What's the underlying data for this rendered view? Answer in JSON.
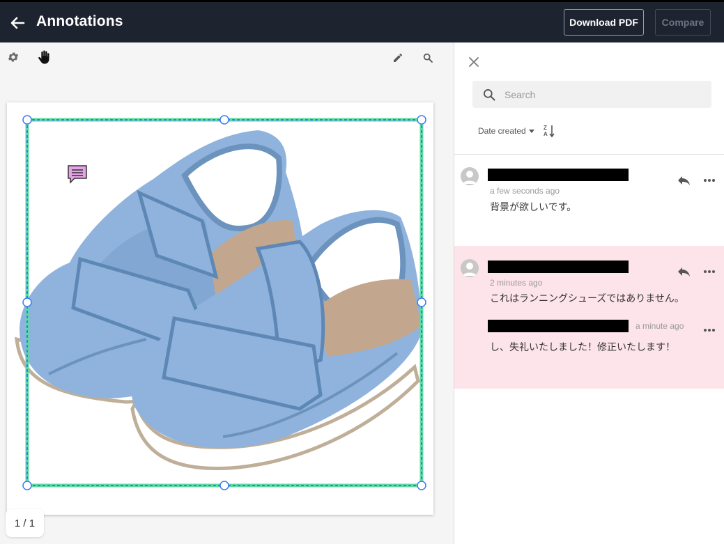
{
  "header": {
    "title": "Annotations",
    "download_label": "Download PDF",
    "compare_label": "Compare",
    "back_icon": "arrow-left-icon"
  },
  "viewer": {
    "tools": [
      "gear-icon",
      "hand-pan-icon",
      "pencil-icon",
      "search-icon"
    ],
    "page_indicator": "1 / 1",
    "document_image": "light-blue-velcro-shoes-illustration"
  },
  "panel": {
    "search_placeholder": "Search",
    "sort_label": "Date created",
    "sort_direction_icon": "sort-z-a-icon",
    "comments": [
      {
        "author_redacted": true,
        "time": "a few seconds ago",
        "text": "背景が欲しいです。",
        "highlighted": false
      },
      {
        "author_redacted": true,
        "time": "2 minutes ago",
        "text": "これはランニングシューズではありません。",
        "highlighted": true,
        "reply": {
          "author_redacted": true,
          "time": "a minute ago",
          "text": "し、失礼いたしました！修正いたします！"
        }
      }
    ]
  },
  "colors": {
    "topbar": "#1e2330",
    "highlight": "#fde3ea",
    "selection_green": "#5fd9a6",
    "selection_blue": "#3b7bf0",
    "comment_marker": "#e6a2e6"
  }
}
